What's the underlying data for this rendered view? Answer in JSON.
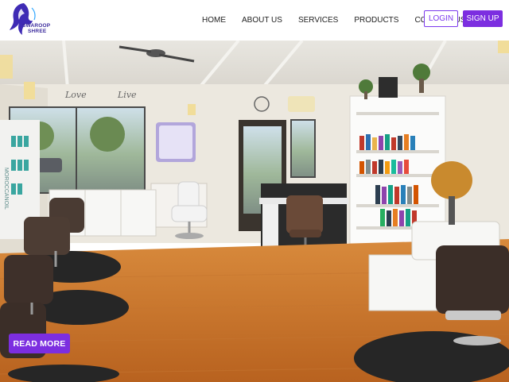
{
  "brand": {
    "name_line1": "SWAROOP",
    "name_line2": "SHREE",
    "logo_icon": "woman-silhouette-logo",
    "accent": "#7c2ee0",
    "logo_color": "#3a2a9c"
  },
  "nav": {
    "links": [
      "HOME",
      "ABOUT US",
      "SERVICES",
      "PRODUCTS",
      "CONTACT US"
    ],
    "login_label": "LOGIN",
    "signup_label": "SIGN UP"
  },
  "hero": {
    "image": "salon-interior-photo",
    "wall_text_1": "Love",
    "wall_text_2": "Live",
    "shelf_text": "MOROCCANOIL",
    "cta_label": "READ MORE"
  }
}
